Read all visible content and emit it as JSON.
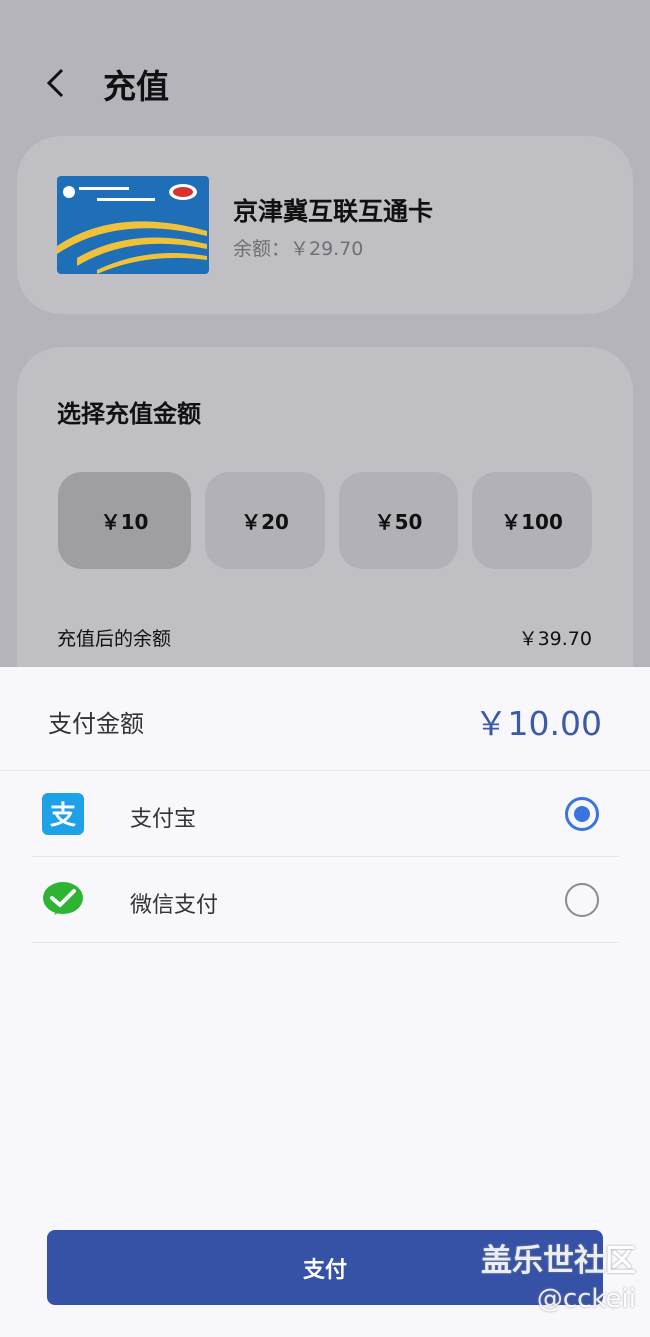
{
  "header": {
    "title": "充值"
  },
  "card": {
    "name": "京津冀互联互通卡",
    "balance": "余额：￥29.70",
    "image_icon": "transit-card-icon"
  },
  "amount_section": {
    "title": "选择充值金额",
    "options": [
      "￥10",
      "￥20",
      "￥50",
      "￥100"
    ],
    "selected": "￥10",
    "after_label": "充值后的余额",
    "after_value": "￥39.70"
  },
  "payment": {
    "label": "支付金额",
    "amount": "￥10.00",
    "methods": [
      {
        "label": "支付宝",
        "icon": "alipay-icon",
        "selected": true
      },
      {
        "label": "微信支付",
        "icon": "wechat-pay-icon",
        "selected": false
      }
    ],
    "pay_button": "支付"
  },
  "watermark": {
    "title": "盖乐世社区",
    "handle": "@cckeii"
  },
  "colors": {
    "accent": "#3552a6",
    "radio": "#3a74e0",
    "amount_text": "#3d5aa6"
  }
}
